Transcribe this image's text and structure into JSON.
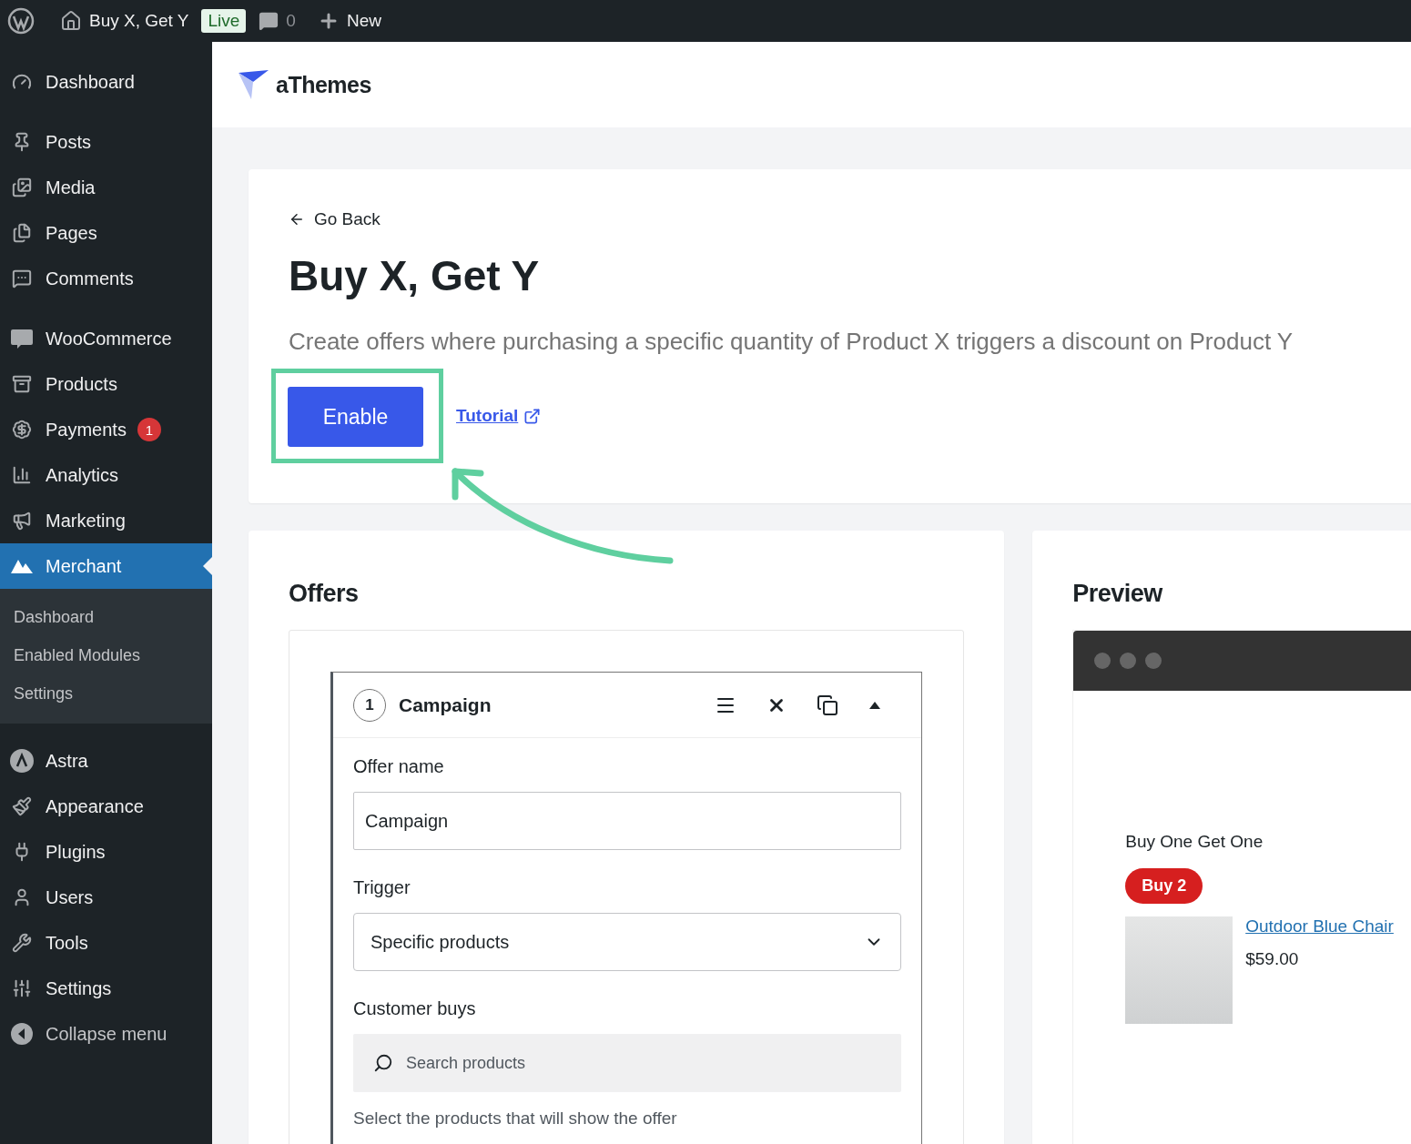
{
  "topbar": {
    "site_title": "Buy X, Get Y",
    "status_badge": "Live",
    "comments_count": "0",
    "new_label": "New"
  },
  "sidebar": {
    "groups": [
      [
        {
          "label": "Dashboard",
          "selected": false
        }
      ],
      [
        {
          "label": "Posts",
          "selected": false
        },
        {
          "label": "Media",
          "selected": false
        },
        {
          "label": "Pages",
          "selected": false
        },
        {
          "label": "Comments",
          "selected": false
        }
      ],
      [
        {
          "label": "WooCommerce",
          "selected": false
        },
        {
          "label": "Products",
          "selected": false
        },
        {
          "label": "Payments",
          "selected": false,
          "badge": "1"
        },
        {
          "label": "Analytics",
          "selected": false
        },
        {
          "label": "Marketing",
          "selected": false
        },
        {
          "label": "Merchant",
          "selected": true,
          "children": [
            {
              "label": "Dashboard",
              "selected": false
            },
            {
              "label": "Enabled Modules",
              "selected": false
            },
            {
              "label": "Settings",
              "selected": false
            }
          ]
        }
      ],
      [
        {
          "label": "Astra",
          "selected": false
        },
        {
          "label": "Appearance",
          "selected": false
        },
        {
          "label": "Plugins",
          "selected": false
        },
        {
          "label": "Users",
          "selected": false
        },
        {
          "label": "Tools",
          "selected": false
        },
        {
          "label": "Settings",
          "selected": false
        },
        {
          "label": "Collapse menu",
          "selected": false
        }
      ]
    ]
  },
  "brand": "aThemes",
  "module": {
    "back_link": "Go Back",
    "title": "Buy X, Get Y",
    "description": "Create offers where purchasing a specific quantity of Product X triggers a discount on Product Y",
    "enable_button": "Enable",
    "tutorial_link": "Tutorial"
  },
  "offers": {
    "title": "Offers",
    "offer": {
      "number": "1",
      "name": "Campaign",
      "expanded": true,
      "offer_name": {
        "label": "Offer name",
        "value": "Campaign"
      },
      "trigger": {
        "label": "Trigger",
        "value": "Specific products"
      },
      "customer_buys": {
        "label": "Customer buys",
        "placeholder": "Search products",
        "hint": "Select the products that will show the offer"
      }
    }
  },
  "preview": {
    "title": "Preview",
    "heading": "Buy One Get One",
    "badge": "Buy 2",
    "product_name": "Outdoor Blue Chair",
    "price": "$59.00"
  }
}
